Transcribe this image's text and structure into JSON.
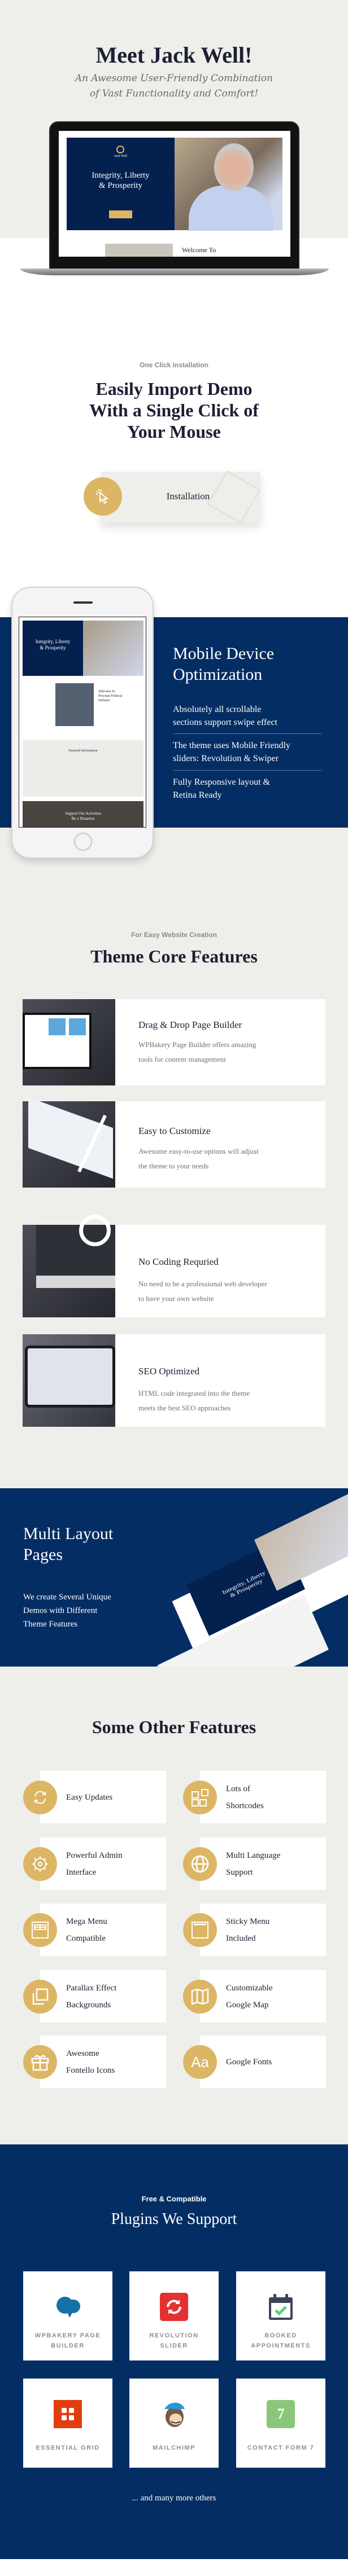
{
  "hero": {
    "title": "Meet Jack Well!",
    "subtitle_lines": [
      "An Awesome User-Friendly Combination",
      "of Vast Functionality  and Comfort!"
    ],
    "mockup": {
      "brand": "Jack Well",
      "headline_lines": [
        "Integrity, Liberty",
        "& Prosperity"
      ],
      "welcome": "Welcome To"
    }
  },
  "install": {
    "eyebrow": "One Click Installation",
    "heading_lines": [
      "Easily Import Demo",
      "With a Single Click of",
      "Your Mouse"
    ],
    "card_label": "Installation",
    "card_icon": "cursor-click-icon"
  },
  "mobile": {
    "title_lines": [
      "Mobile Device",
      "Optimization"
    ],
    "items": [
      {
        "lines": [
          "Absolutely all scrollable",
          "sections support swipe effect"
        ]
      },
      {
        "lines": [
          "The theme uses Mobile Friendly",
          "sliders: Revolution & Swiper"
        ]
      },
      {
        "lines": [
          "Fully Responsive layout &",
          "Retina Ready"
        ]
      }
    ],
    "mockup": {
      "headline_lines": [
        "Integrity, Liberty",
        "& Prosperity"
      ],
      "welcome_lines": [
        "Welcome To",
        "Personal Political",
        "Website!"
      ],
      "featured": "Featured Information",
      "donation_lines": [
        "Support Our Activities",
        "By a Donation"
      ]
    }
  },
  "core": {
    "eyebrow": "For Easy Website Creation",
    "title": "Theme Core Features",
    "features": [
      {
        "title": "Drag & Drop Page  Builder",
        "desc_lines": [
          "WPBakery Page Builder offers amazing",
          "tools for content management"
        ]
      },
      {
        "title": "Easy to Customize",
        "desc_lines": [
          "Awesome easy-to-use options will adjust",
          "the theme to your needs"
        ]
      },
      {
        "title": "No Coding Requried",
        "desc_lines": [
          "No need to be a professional web developer",
          "to have your own website"
        ]
      },
      {
        "title": "SEO Optimized",
        "desc_lines": [
          "HTML code integrated into the theme",
          "meets the best SEO approaches"
        ]
      }
    ]
  },
  "multi": {
    "title_lines": [
      "Multi Layout",
      "Pages"
    ],
    "desc_lines": [
      "We create Several Unique",
      "Demos with Different",
      "Theme Features"
    ],
    "mockup": {
      "headline_lines": [
        "Integrity, Liberty",
        "& Prosperity"
      ]
    }
  },
  "other": {
    "title": "Some Other Features",
    "items": [
      {
        "lines": [
          "Easy Updates"
        ],
        "icon": "refresh-icon"
      },
      {
        "lines": [
          "Lots of",
          "Shortcodes"
        ],
        "icon": "shortcodes-icon"
      },
      {
        "lines": [
          "Powerful Admin",
          "Interface"
        ],
        "icon": "gear-icon"
      },
      {
        "lines": [
          "Multi Language",
          "Support"
        ],
        "icon": "globe-icon"
      },
      {
        "lines": [
          "Mega Menu",
          "Compatible"
        ],
        "icon": "mega-menu-icon"
      },
      {
        "lines": [
          "Sticky Menu",
          "Included"
        ],
        "icon": "sticky-menu-icon"
      },
      {
        "lines": [
          "Parallax Effect",
          "Backgrounds"
        ],
        "icon": "layers-icon"
      },
      {
        "lines": [
          "Customizable",
          "Google Map"
        ],
        "icon": "map-icon"
      },
      {
        "lines": [
          "Awesome",
          "Fontello Icons"
        ],
        "icon": "gift-icon"
      },
      {
        "lines": [
          "Google Fonts"
        ],
        "icon": "font-icon",
        "icon_text": "Aa"
      }
    ]
  },
  "plugins": {
    "eyebrow": "Free & Compatible",
    "title": "Plugins We Support",
    "items": [
      {
        "lines": [
          "WPBAKERY PAGE",
          "BUILDER"
        ],
        "icon": "wpbakery-icon"
      },
      {
        "lines": [
          "REVOLUTION",
          "SLIDER"
        ],
        "icon": "revolution-slider-icon"
      },
      {
        "lines": [
          "BOOKED",
          "APPOINTMENTS"
        ],
        "icon": "calendar-check-icon"
      },
      {
        "lines": [
          "ESSENTIAL GRID"
        ],
        "icon": "essential-grid-icon"
      },
      {
        "lines": [
          "MAILCHIMP"
        ],
        "icon": "mailchimp-icon"
      },
      {
        "lines": [
          "CONTACT FORM 7"
        ],
        "icon": "contact-form-7-icon",
        "icon_text": "7"
      }
    ],
    "footer": "... and many more others"
  },
  "colors": {
    "navy": "#042d63",
    "gold": "#dcb665",
    "light_bg": "#eeeeea",
    "heading": "#1c1f33"
  }
}
